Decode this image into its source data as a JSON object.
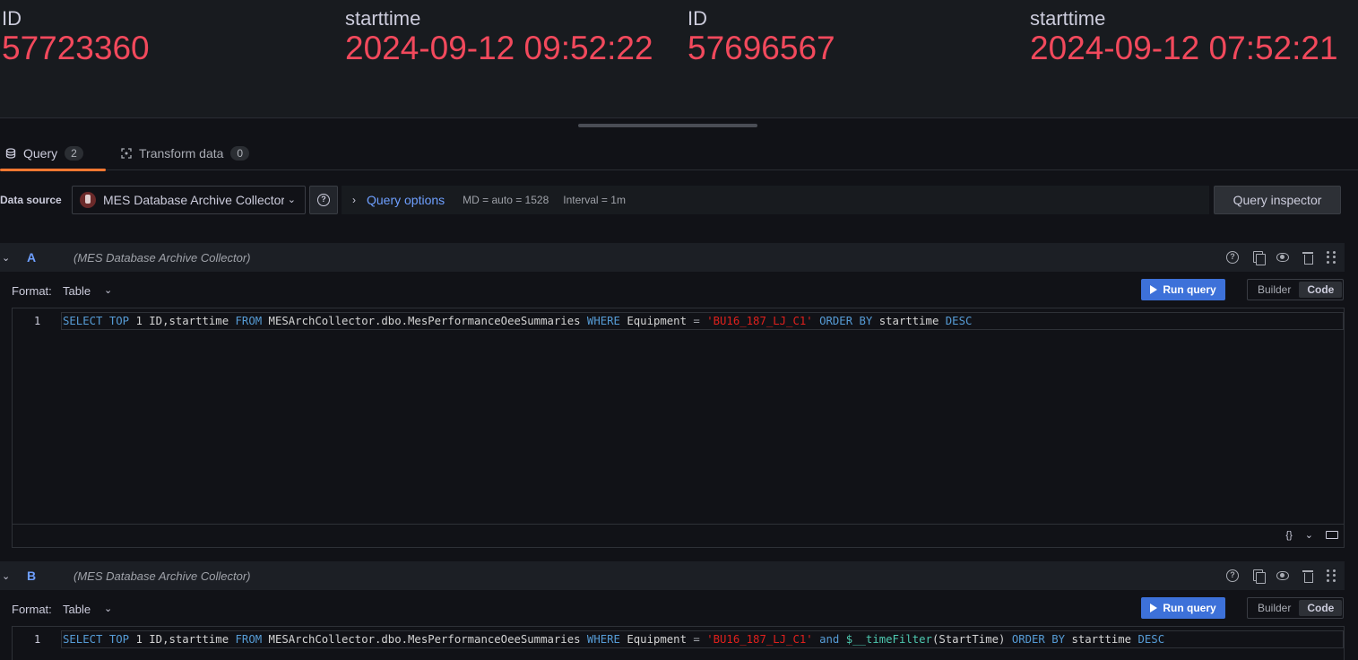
{
  "stats": [
    {
      "title": "ID",
      "value": "57723360"
    },
    {
      "title": "starttime",
      "value": "2024-09-12 09:52:22"
    },
    {
      "title": "ID",
      "value": "57696567"
    },
    {
      "title": "starttime",
      "value": "2024-09-12 07:52:21"
    }
  ],
  "tabs": [
    {
      "label": "Query",
      "count": "2"
    },
    {
      "label": "Transform data",
      "count": "0"
    }
  ],
  "datasource": {
    "label": "Data source",
    "selected": "MES Database Archive Collector",
    "help": "?",
    "query_options_label": "Query options",
    "md": "MD = auto = 1528",
    "interval": "Interval = 1m",
    "inspector_label": "Query inspector"
  },
  "queries": [
    {
      "letter": "A",
      "datasource": "(MES Database Archive Collector)",
      "format_label": "Format:",
      "format_value": "Table",
      "run_label": "Run query",
      "builder_label": "Builder",
      "code_label": "Code",
      "line_number": "1",
      "sql": {
        "select": "SELECT",
        "top": "TOP",
        "n": "1",
        "cols": "ID,starttime",
        "from": "FROM",
        "table": "MESArchCollector.dbo.MesPerformanceOeeSummaries",
        "where": "WHERE",
        "field": "Equipment",
        "eq": "=",
        "value": "'BU16_187_LJ_C1'",
        "order": "ORDER BY",
        "sort_col": "starttime",
        "desc": "DESC"
      }
    },
    {
      "letter": "B",
      "datasource": "(MES Database Archive Collector)",
      "format_label": "Format:",
      "format_value": "Table",
      "run_label": "Run query",
      "builder_label": "Builder",
      "code_label": "Code",
      "line_number": "1",
      "sql": {
        "select": "SELECT",
        "top": "TOP",
        "n": "1",
        "cols": "ID,starttime",
        "from": "FROM",
        "table": "MESArchCollector.dbo.MesPerformanceOeeSummaries",
        "where": "WHERE",
        "field": "Equipment",
        "eq": "=",
        "value": "'BU16_187_LJ_C1'",
        "and": "and",
        "macro": "$__timeFilter",
        "macro_arg": "(StartTime)",
        "order": "ORDER BY",
        "sort_col": "starttime",
        "desc": "DESC"
      }
    }
  ],
  "editor_footer": {
    "braces": "{}",
    "chevron": "⌄"
  },
  "colors": {
    "stat_value": "#f2495c",
    "accent": "#6e9fff",
    "tab_underline": "#ff7831",
    "run_button": "#3d71d9"
  }
}
